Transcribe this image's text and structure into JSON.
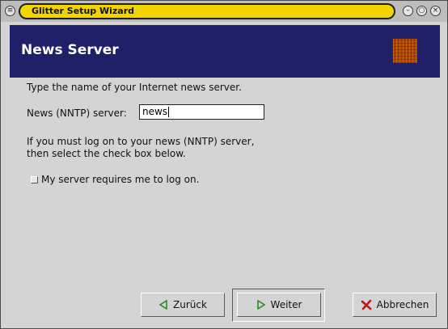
{
  "window": {
    "title": "Glitter Setup Wizard"
  },
  "header": {
    "title": "News Server"
  },
  "content": {
    "intro": "Type the name of your Internet news server.",
    "server_label": "News (NNTP) server:",
    "server_value": "news",
    "login_line1": "If you must log on to your news (NNTP) server,",
    "login_line2": "then select the check box below.",
    "checkbox_label": "My server requires me to log on.",
    "checkbox_checked": false
  },
  "buttons": {
    "back": "Zurück",
    "next": "Weiter",
    "cancel": "Abbrechen"
  },
  "icons": {
    "window_menu": "menu-icon",
    "minimize": "minimize-icon",
    "maximize": "maximize-icon",
    "close": "close-icon",
    "back": "arrow-left-icon",
    "next": "arrow-right-icon",
    "cancel": "x-icon"
  },
  "colors": {
    "header_bg": "#202068",
    "title_pill": "#f2d400",
    "cancel_icon": "#c01818",
    "arrow_icon": "#2a8a2a"
  }
}
